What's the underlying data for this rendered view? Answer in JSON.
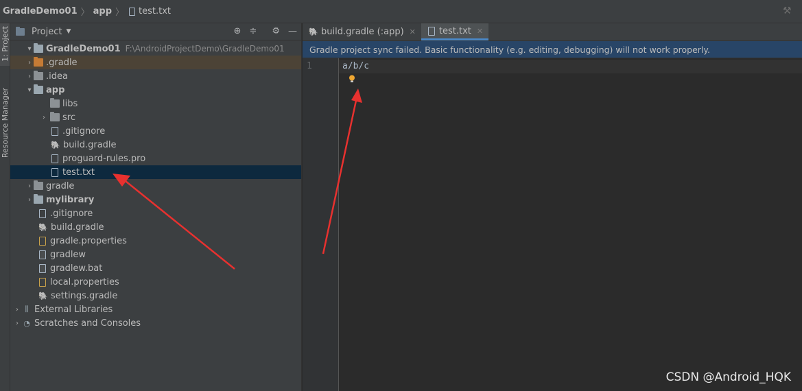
{
  "breadcrumb": {
    "project": "GradleDemo01",
    "module": "app",
    "file": "test.txt"
  },
  "toolstrip": {
    "project_tab": "1: Project",
    "resource_tab": "Resource Manager"
  },
  "project_panel": {
    "title": "Project",
    "tree": [
      {
        "label": "GradleDemo01",
        "path": "F:\\AndroidProjectDemo\\GradleDemo01"
      },
      {
        "label": ".gradle"
      },
      {
        "label": ".idea"
      },
      {
        "label": "app"
      },
      {
        "label": "libs"
      },
      {
        "label": "src"
      },
      {
        "label": ".gitignore"
      },
      {
        "label": "build.gradle"
      },
      {
        "label": "proguard-rules.pro"
      },
      {
        "label": "test.txt"
      },
      {
        "label": "gradle"
      },
      {
        "label": "mylibrary"
      },
      {
        "label": ".gitignore"
      },
      {
        "label": "build.gradle"
      },
      {
        "label": "gradle.properties"
      },
      {
        "label": "gradlew"
      },
      {
        "label": "gradlew.bat"
      },
      {
        "label": "local.properties"
      },
      {
        "label": "settings.gradle"
      },
      {
        "label": "External Libraries"
      },
      {
        "label": "Scratches and Consoles"
      }
    ]
  },
  "editor": {
    "tabs": [
      {
        "label": "build.gradle (:app)"
      },
      {
        "label": "test.txt"
      }
    ],
    "notice": "Gradle project sync failed. Basic functionality (e.g. editing, debugging) will not work properly.",
    "line_number": "1",
    "code": "a/b/c"
  },
  "watermark": "CSDN @Android_HQK",
  "colors": {
    "annotation_arrow": "#e8312f",
    "selection": "#0d293e",
    "notice_bg": "#284567",
    "tab_underline": "#4a88c7"
  }
}
